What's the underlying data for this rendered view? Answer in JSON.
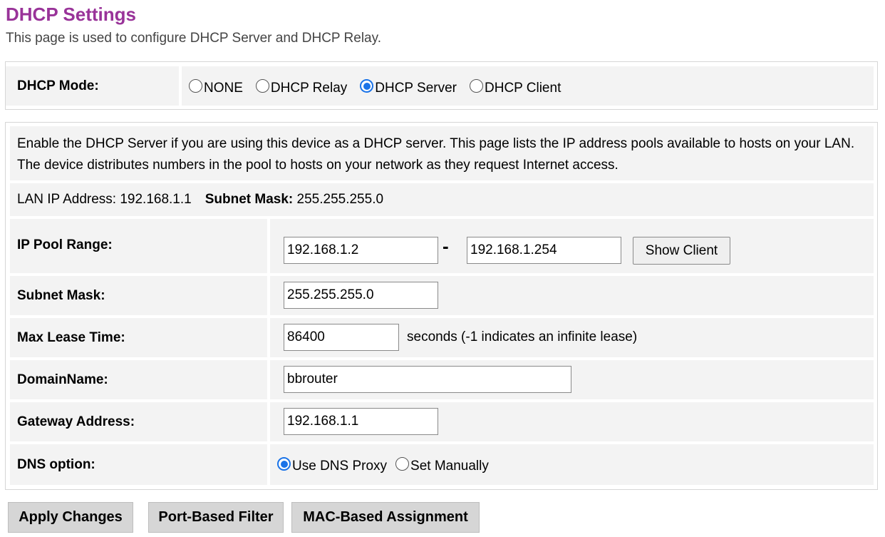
{
  "page": {
    "title": "DHCP Settings",
    "subtitle": "This page is used to configure DHCP Server and DHCP Relay."
  },
  "mode": {
    "label": "DHCP Mode:",
    "options": [
      "NONE",
      "DHCP Relay",
      "DHCP Server",
      "DHCP Client"
    ],
    "selected": "DHCP Server"
  },
  "server": {
    "description": "Enable the DHCP Server if you are using this device as a DHCP server. This page lists the IP address pools available to hosts on your LAN. The device distributes numbers in the pool to hosts on your network as they request Internet access.",
    "lan_ip_label": "LAN IP Address:",
    "lan_ip_value": "192.168.1.1",
    "subnet_label": "Subnet Mask:",
    "subnet_value": "255.255.255.0",
    "pool": {
      "label": "IP Pool Range:",
      "start": "192.168.1.2",
      "separator": "-",
      "end": "192.168.1.254",
      "show_client_label": "Show Client"
    },
    "subnet_mask": {
      "label": "Subnet Mask:",
      "value": "255.255.255.0"
    },
    "lease": {
      "label": "Max Lease Time:",
      "value": "86400",
      "suffix": "seconds (-1 indicates an infinite lease)"
    },
    "domain": {
      "label": "DomainName:",
      "value": "bbrouter"
    },
    "gateway": {
      "label": "Gateway Address:",
      "value": "192.168.1.1"
    },
    "dns": {
      "label": "DNS option:",
      "options": [
        "Use DNS Proxy",
        "Set Manually"
      ],
      "selected": "Use DNS Proxy"
    }
  },
  "buttons": {
    "apply": "Apply Changes",
    "port_filter": "Port-Based Filter",
    "mac_assignment": "MAC-Based Assignment"
  },
  "colors": {
    "title": "#993399",
    "radio_selected": "#1a73e8",
    "cell_background": "#f3f3f3",
    "button_background": "#d6d6d6"
  }
}
